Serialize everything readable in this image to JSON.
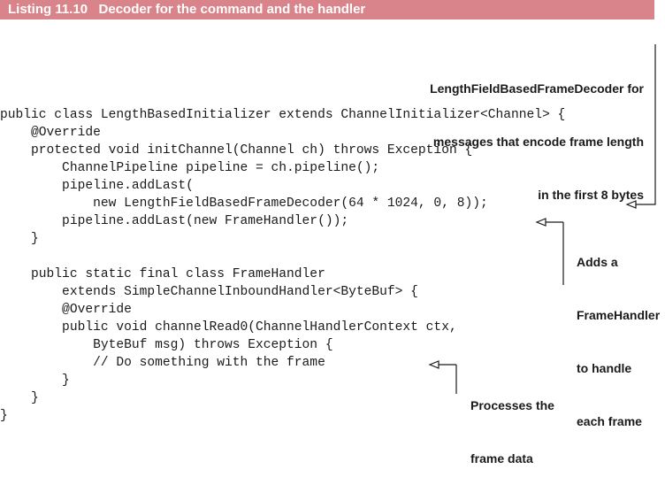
{
  "listing": {
    "title": "Listing 11.10   Decoder for the command and the handler"
  },
  "code_lines": [
    "public class LengthBasedInitializer extends ChannelInitializer<Channel> {",
    "    @Override",
    "    protected void initChannel(Channel ch) throws Exception {",
    "        ChannelPipeline pipeline = ch.pipeline();",
    "        pipeline.addLast(",
    "            new LengthFieldBasedFrameDecoder(64 * 1024, 0, 8));",
    "        pipeline.addLast(new FrameHandler());",
    "    }",
    "",
    "    public static final class FrameHandler",
    "        extends SimpleChannelInboundHandler<ByteBuf> {",
    "        @Override",
    "        public void channelRead0(ChannelHandlerContext ctx,",
    "            ByteBuf msg) throws Exception {",
    "            // Do something with the frame",
    "        }",
    "    }",
    "}"
  ],
  "annotations": {
    "decoder": [
      "LengthFieldBasedFrameDecoder for",
      "messages that encode frame length",
      "in the first 8 bytes"
    ],
    "frame_handler": [
      "Adds a",
      "FrameHandler",
      "to handle",
      "each frame"
    ],
    "processes": [
      "Processes the",
      "frame data"
    ]
  },
  "colors": {
    "header_background": "#d9848a",
    "header_text": "#ffffff",
    "text": "#1a1a1a"
  }
}
